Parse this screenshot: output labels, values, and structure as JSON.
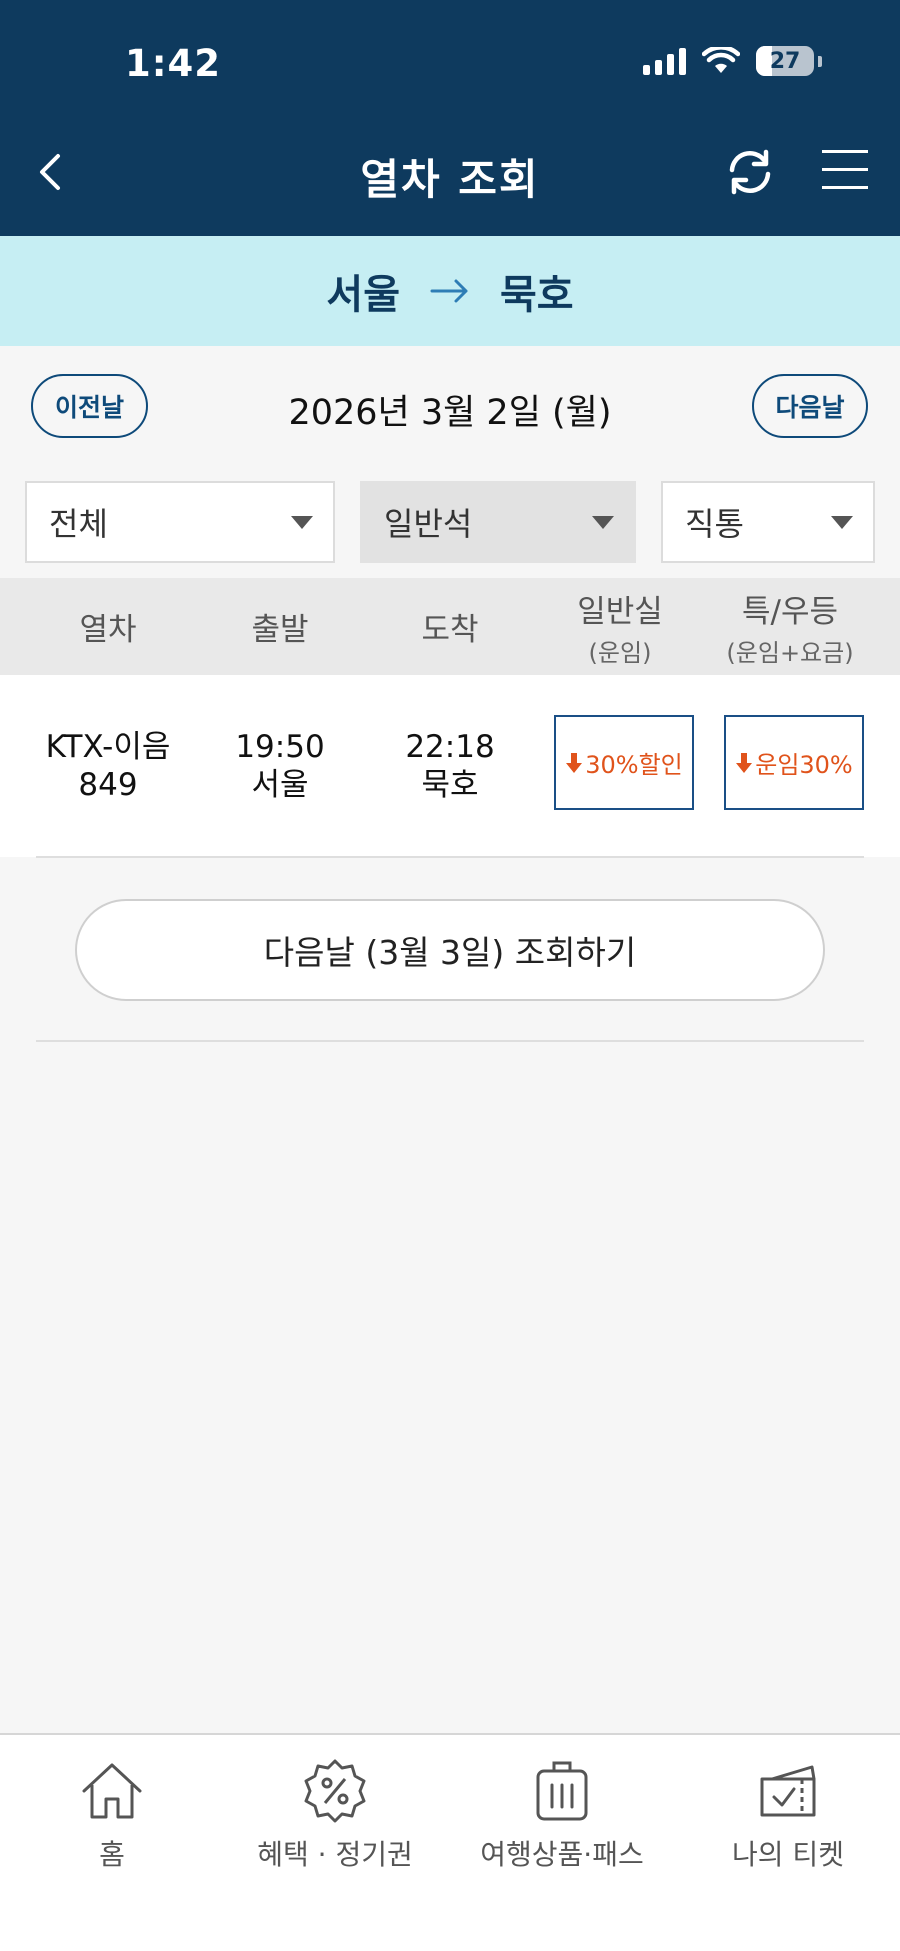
{
  "status_bar": {
    "time": "1:42",
    "battery": "27"
  },
  "header": {
    "title": "열차 조회"
  },
  "route": {
    "from": "서울",
    "to": "묵호"
  },
  "date_nav": {
    "prev_label": "이전날",
    "date": "2026년 3월 2일 (월)",
    "next_label": "다음날"
  },
  "filters": {
    "train_type": "전체",
    "seat_class": "일반석",
    "route_type": "직통"
  },
  "table": {
    "headers": {
      "train": "열차",
      "departure": "출발",
      "arrival": "도착",
      "standard": "일반실",
      "standard_sub": "(운임)",
      "first": "특/우등",
      "first_sub": "(운임+요금)"
    },
    "rows": [
      {
        "train_name": "KTX-이음",
        "train_no": "849",
        "dep_time": "19:50",
        "dep_station": "서울",
        "arr_time": "22:18",
        "arr_station": "묵호",
        "standard_fare": "30%할인",
        "first_fare": "운임30%"
      }
    ]
  },
  "next_day_search": "다음날 (3월 3일) 조회하기",
  "tabbar": {
    "home": "홈",
    "benefits": "혜택 · 정기권",
    "travel": "여행상품·패스",
    "tickets": "나의 티켓"
  },
  "colors": {
    "header_bg": "#0e3a5e",
    "route_bg": "#c6eef3",
    "discount": "#e0531b",
    "border_blue": "#1a4f86"
  }
}
